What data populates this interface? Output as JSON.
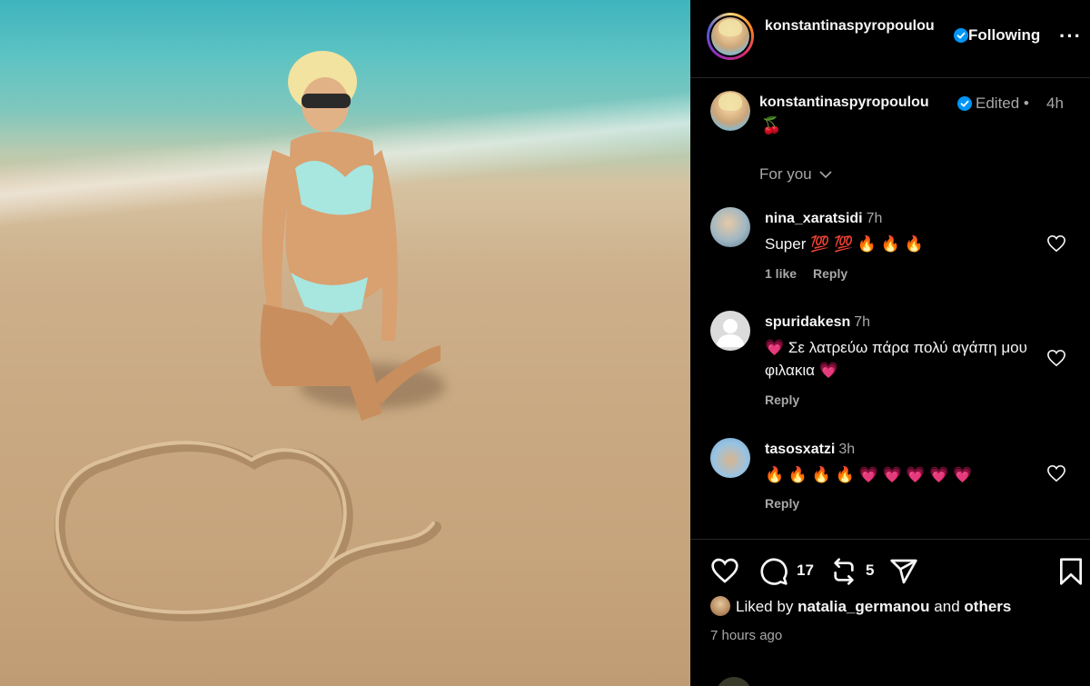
{
  "header": {
    "username": "konstantinaspyropoulou",
    "follow_label": "Following",
    "more_label": "···"
  },
  "caption": {
    "username": "konstantinaspyropoulou",
    "edited_label": "Edited •",
    "time": "4h",
    "text": "🍒"
  },
  "filter": {
    "label": "For you",
    "chevron": "chevron-down-icon"
  },
  "comments": [
    {
      "username": "nina_xaratsidi",
      "time": "7h",
      "text": "Super 💯 💯 🔥 🔥 🔥",
      "likes": "1 like",
      "reply": "Reply"
    },
    {
      "username": "spuridakesn",
      "time": "7h",
      "text": "💗 Σε λατρεύω πάρα πολύ αγάπη μου φιλακια 💗",
      "reply": "Reply"
    },
    {
      "username": "tasosxatzi",
      "time": "3h",
      "text": "🔥 🔥 🔥 🔥 💗 💗 💗 💗 💗",
      "reply": "Reply"
    }
  ],
  "actions": {
    "comment_count": "17",
    "repost_count": "5"
  },
  "likes": {
    "prefix": "Liked by",
    "user": "natalia_germanou",
    "middle": "and",
    "others": "others"
  },
  "timestamp": "7 hours ago",
  "colors": {
    "background": "#000000",
    "text": "#f5f5f5",
    "muted": "#a8a8a8",
    "verified": "#0095f6",
    "heart_emoji": "#ff2f6d"
  }
}
